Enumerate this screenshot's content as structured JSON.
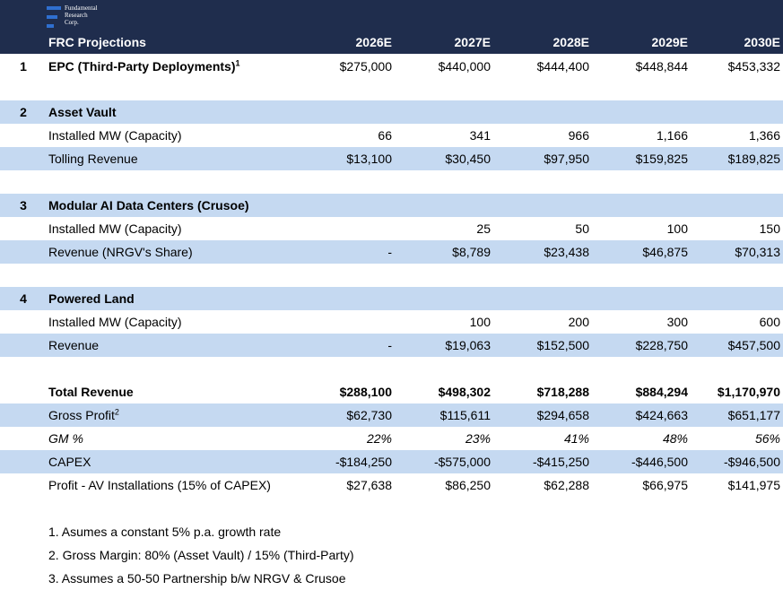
{
  "logo": {
    "line1": "Fundamental",
    "line2": "Research",
    "line3": "Corp."
  },
  "header": {
    "title": "FRC Projections",
    "years": [
      "2026E",
      "2027E",
      "2028E",
      "2029E",
      "2030E"
    ]
  },
  "epc": {
    "num": "1",
    "label": "EPC (Third-Party Deployments)",
    "sup": "1",
    "values": [
      "$275,000",
      "$440,000",
      "$444,400",
      "$448,844",
      "$453,332"
    ]
  },
  "asset_vault": {
    "num": "2",
    "title": "Asset Vault",
    "installed_label": "Installed MW (Capacity)",
    "installed": [
      "66",
      "341",
      "966",
      "1,166",
      "1,366"
    ],
    "revenue_label": "Tolling Revenue",
    "revenue": [
      "$13,100",
      "$30,450",
      "$97,950",
      "$159,825",
      "$189,825"
    ]
  },
  "modular": {
    "num": "3",
    "title": "Modular AI Data Centers (Crusoe)",
    "installed_label": "Installed MW (Capacity)",
    "installed": [
      "",
      "25",
      "50",
      "100",
      "150"
    ],
    "revenue_label": "Revenue (NRGV's Share)",
    "revenue": [
      "-",
      "$8,789",
      "$23,438",
      "$46,875",
      "$70,313"
    ]
  },
  "powered_land": {
    "num": "4",
    "title": "Powered Land",
    "installed_label": "Installed MW (Capacity)",
    "installed": [
      "",
      "100",
      "200",
      "300",
      "600"
    ],
    "revenue_label": "Revenue",
    "revenue": [
      "-",
      "$19,063",
      "$152,500",
      "$228,750",
      "$457,500"
    ]
  },
  "totals": {
    "total_label": "Total Revenue",
    "total": [
      "$288,100",
      "$498,302",
      "$718,288",
      "$884,294",
      "$1,170,970"
    ],
    "gp_label": "Gross Profit",
    "gp_sup": "2",
    "gp": [
      "$62,730",
      "$115,611",
      "$294,658",
      "$424,663",
      "$651,177"
    ],
    "gm_label": "GM %",
    "gm": [
      "22%",
      "23%",
      "41%",
      "48%",
      "56%"
    ],
    "capex_label": "CAPEX",
    "capex": [
      "-$184,250",
      "-$575,000",
      "-$415,250",
      "-$446,500",
      "-$946,500"
    ],
    "profit_label": "Profit - AV Installations (15% of CAPEX)",
    "profit": [
      "$27,638",
      "$86,250",
      "$62,288",
      "$66,975",
      "$141,975"
    ]
  },
  "notes": [
    "1. Asumes a constant  5% p.a. growth rate",
    "2. Gross Margin: 80% (Asset Vault) / 15% (Third-Party)",
    "3. Assumes a 50-50 Partnership b/w NRGV & Crusoe"
  ]
}
